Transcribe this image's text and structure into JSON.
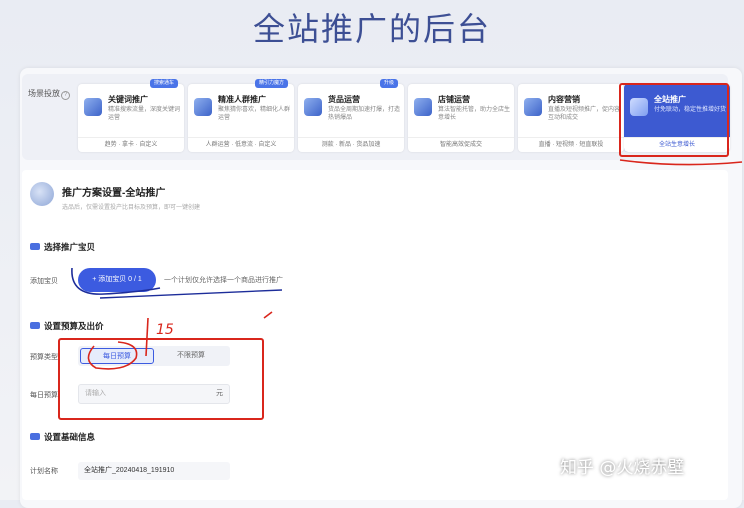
{
  "page_title": "全站推广的后台",
  "scene": {
    "label": "场景投放",
    "cards": [
      {
        "title": "关键词推广",
        "desc": "精准搜索流量，深度关键词运营",
        "footer": "趋势 · 拿卡 · 自定义",
        "badge": "搜索通车"
      },
      {
        "title": "精准人群推广",
        "desc": "聚焦猜你喜欢，精细化人群运营",
        "footer": "人群运营 · 低意流 · 自定义",
        "badge": "精引力魔方"
      },
      {
        "title": "货品运营",
        "desc": "货品全周期加速打爆，打造热销爆品",
        "footer": "测款 · 新品 · 货品加速",
        "badge": "升级"
      },
      {
        "title": "店铺运营",
        "desc": "算法智能托管，助力全店生意增长",
        "footer": "智能高效促成交",
        "badge": ""
      },
      {
        "title": "内容营销",
        "desc": "直播及短视频推广，促内容互动和成交",
        "footer": "直播 · 短视频 · 短直联投",
        "badge": ""
      },
      {
        "title": "全站推广",
        "desc": "付免联动，稳定性推增好货",
        "footer": "全站生意增长",
        "badge": ""
      }
    ]
  },
  "plan": {
    "title": "推广方案设置-全站推广",
    "subtitle": "选品后，仅需设置投产比目标及预算，即可一键创建"
  },
  "section_item": {
    "title": "选择推广宝贝",
    "field_label": "添加宝贝",
    "add_button": "+ 添加宝贝 0 / 1",
    "hint": "一个计划仅允许选择一个商品进行推广"
  },
  "section_budget": {
    "title": "设置预算及出价",
    "type_label": "预算类型",
    "option_daily": "每日预算",
    "option_unlimited": "不限预算",
    "daily_label": "每日预算",
    "daily_placeholder": "请输入",
    "unit": "元"
  },
  "section_basic": {
    "title": "设置基础信息",
    "name_label": "计划名称",
    "name_value": "全站推广_20240418_191910"
  },
  "annotation_text": "15",
  "watermark": "知乎 @火烧赤壁",
  "colors": {
    "accent": "#3c5be0",
    "annotation": "#d9261c",
    "title": "#3d4f94"
  }
}
